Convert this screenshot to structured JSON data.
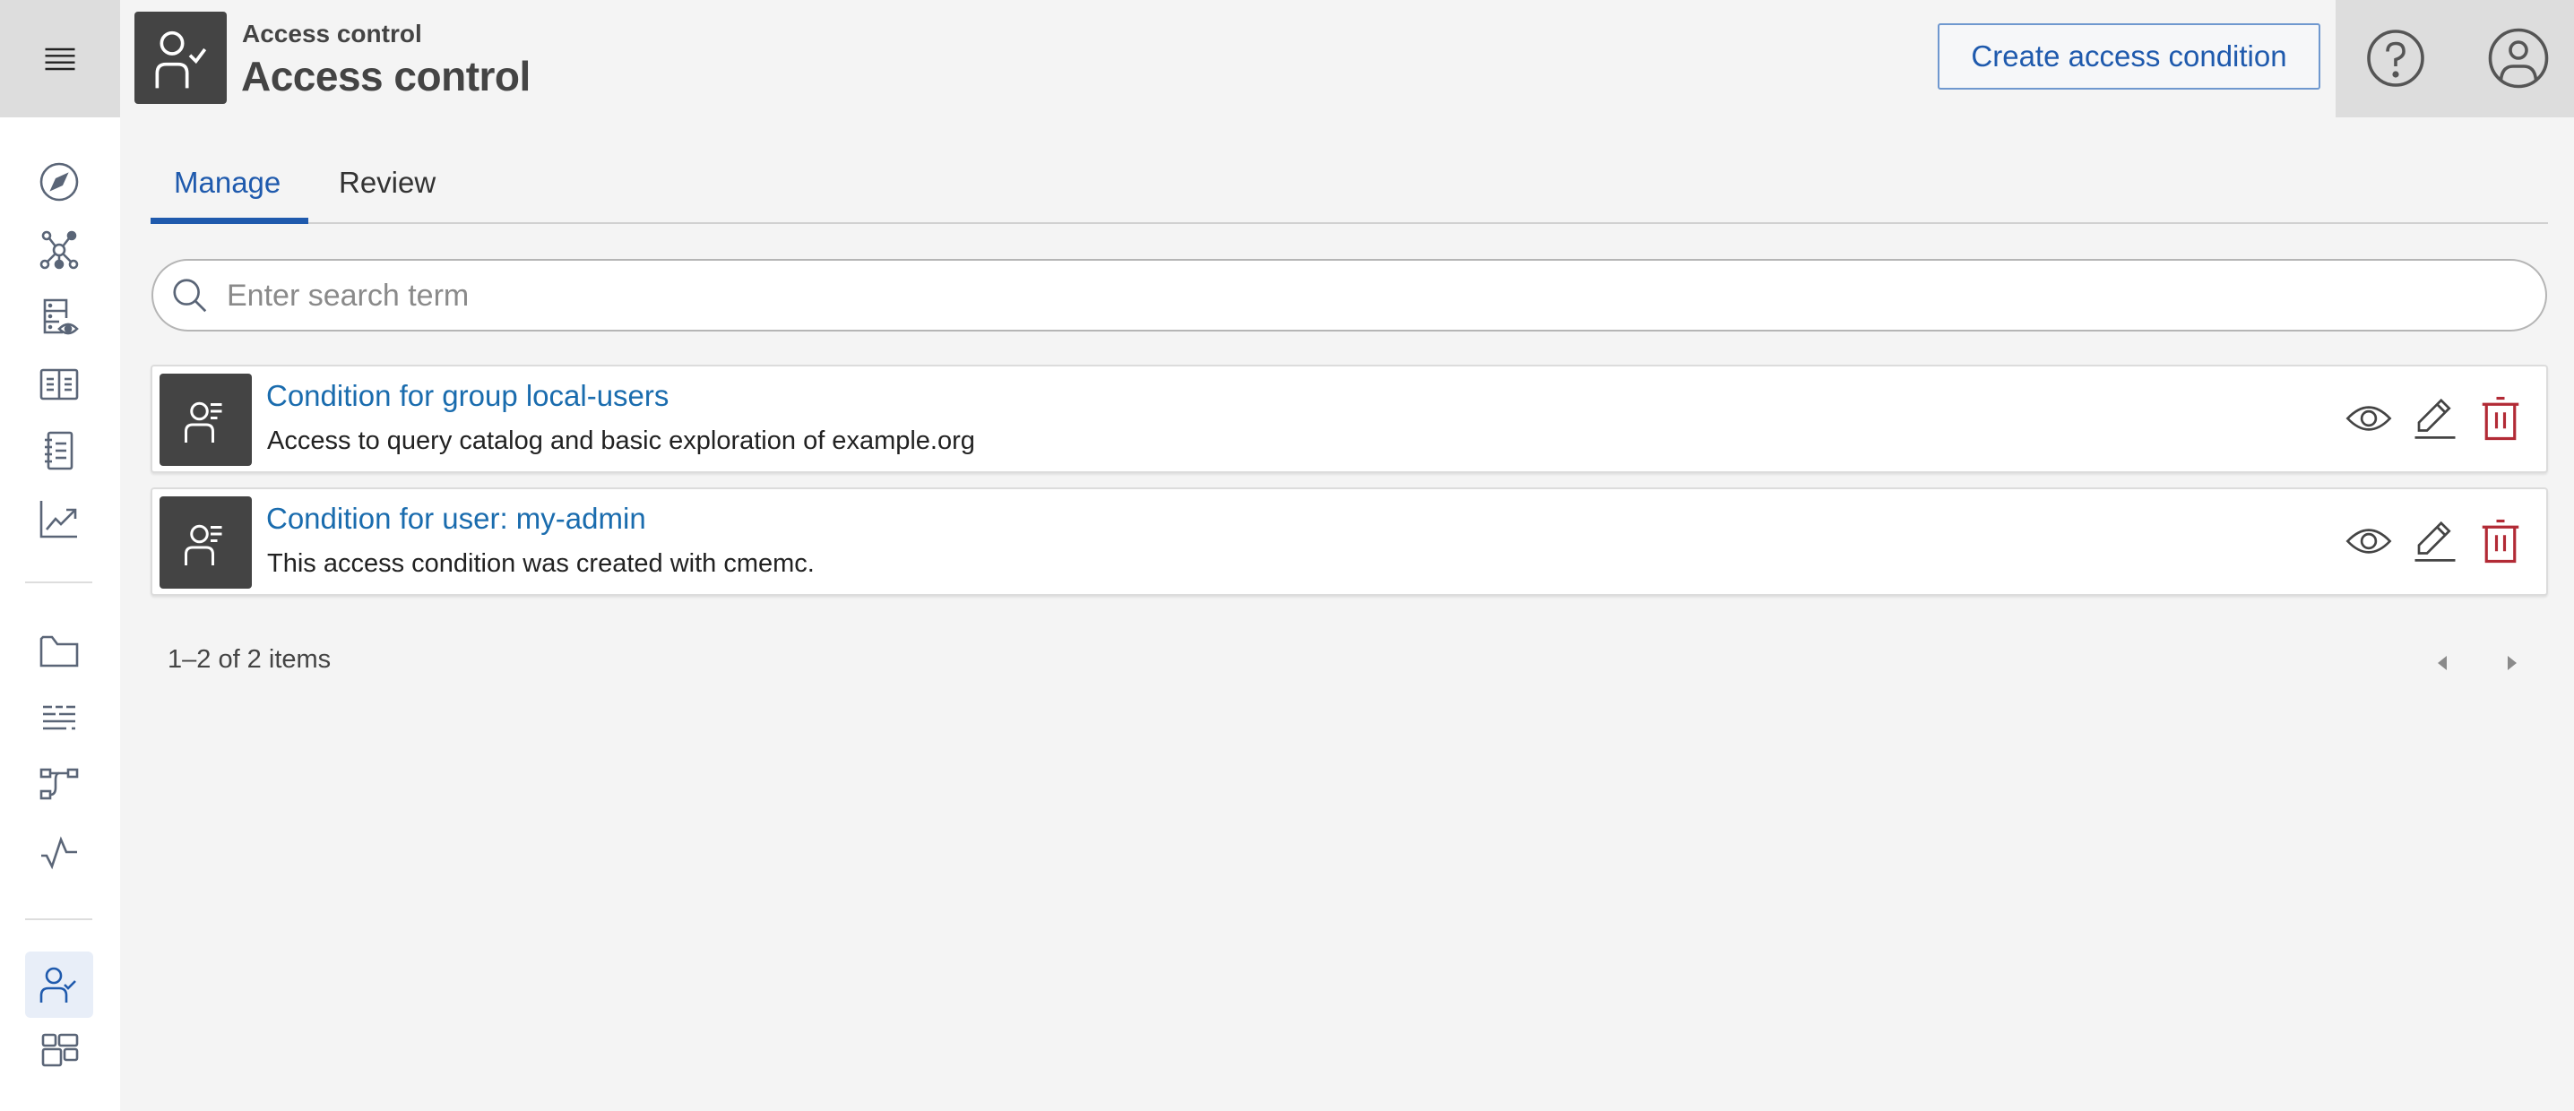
{
  "app": {
    "menu_icon": "hamburger-menu-icon"
  },
  "sidebar": {
    "groups": [
      [
        {
          "id": "explore",
          "icon": "compass-icon",
          "label": "Explore"
        },
        {
          "id": "graph",
          "icon": "knowledge-graph-icon",
          "label": "Knowledge Graphs"
        },
        {
          "id": "vocab",
          "icon": "database-view-icon",
          "label": "Vocabularies"
        },
        {
          "id": "catalog",
          "icon": "book-icon",
          "label": "Business Rules"
        },
        {
          "id": "queries",
          "icon": "notebook-icon",
          "label": "Queries"
        },
        {
          "id": "charts",
          "icon": "chart-icon",
          "label": "Charts"
        }
      ],
      [
        {
          "id": "projects",
          "icon": "folder-icon",
          "label": "Projects"
        },
        {
          "id": "datasets",
          "icon": "lines-icon",
          "label": "Datasets"
        },
        {
          "id": "workflows",
          "icon": "workflow-icon",
          "label": "Workflows"
        },
        {
          "id": "activities",
          "icon": "activity-icon",
          "label": "Activities"
        }
      ],
      [
        {
          "id": "access",
          "icon": "user-check-icon",
          "label": "Access control",
          "active": true
        },
        {
          "id": "dashboard",
          "icon": "dashboard-icon",
          "label": "Dashboard"
        }
      ]
    ]
  },
  "header": {
    "subtitle": "Access control",
    "title": "Access control",
    "icon": "user-check-icon",
    "create_button": "Create access condition",
    "help_icon": "help-icon",
    "user_icon": "user-avatar-icon"
  },
  "tabs": [
    {
      "label": "Manage",
      "active": true
    },
    {
      "label": "Review",
      "active": false
    }
  ],
  "search": {
    "placeholder": "Enter search term",
    "value": ""
  },
  "conditions": [
    {
      "title": "Condition for group local-users",
      "description": "Access to query catalog and basic exploration of example.org"
    },
    {
      "title": "Condition for user: my-admin",
      "description": "This access condition was created with cmemc."
    }
  ],
  "actions": {
    "view_icon": "eye-icon",
    "edit_icon": "pencil-icon",
    "delete_icon": "trash-icon",
    "delete_color": "#b22a35"
  },
  "pagination": {
    "summary": "1–2 of 2 items"
  },
  "colors": {
    "accent": "#1f5aad",
    "link": "#1a6cae",
    "danger": "#b22a35"
  }
}
